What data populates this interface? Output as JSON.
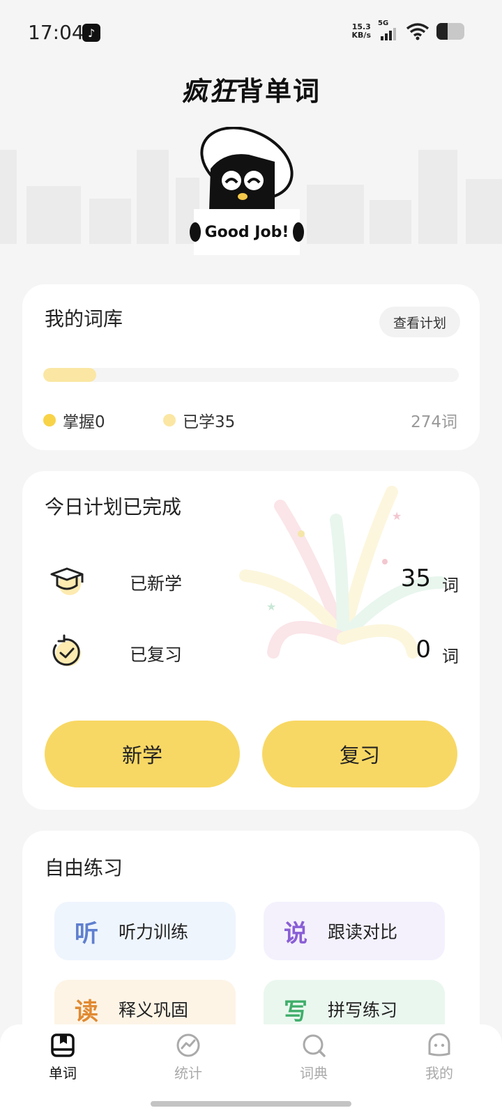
{
  "status_bar": {
    "time": "17:04",
    "net_speed_value": "15.3",
    "net_speed_unit": "KB/s",
    "network_type": "5G"
  },
  "header": {
    "title_part1": "疯狂",
    "title_part2": "背单词",
    "mascot_caption": "Good Job!"
  },
  "library": {
    "title": "我的词库",
    "view_plan_label": "查看计划",
    "progress_fraction": 0.128,
    "mastered_label": "掌握0",
    "learned_label": "已学35",
    "total_label": "274词",
    "colors": {
      "mastered": "#f8d348",
      "learned": "#fbe7a3"
    }
  },
  "plan": {
    "title": "今日计划已完成",
    "new_learned_label": "已新学",
    "new_learned_count": "35",
    "reviewed_label": "已复习",
    "reviewed_count": "0",
    "unit": "词",
    "learn_button": "新学",
    "review_button": "复习"
  },
  "practice": {
    "title": "自由练习",
    "items": [
      {
        "glyph": "听",
        "label": "听力训练",
        "bg": "#eef5fd",
        "color": "#5f7fcf"
      },
      {
        "glyph": "说",
        "label": "跟读对比",
        "bg": "#f4f1fd",
        "color": "#8a5ed6"
      },
      {
        "glyph": "读",
        "label": "释义巩固",
        "bg": "#fdf4e6",
        "color": "#e08a32"
      },
      {
        "glyph": "写",
        "label": "拼写练习",
        "bg": "#eaf7ef",
        "color": "#3fae6a"
      }
    ]
  },
  "tabs": [
    {
      "label": "单词",
      "icon": "book-icon"
    },
    {
      "label": "统计",
      "icon": "chart-icon"
    },
    {
      "label": "词典",
      "icon": "dictionary-search-icon"
    },
    {
      "label": "我的",
      "icon": "profile-icon"
    }
  ]
}
